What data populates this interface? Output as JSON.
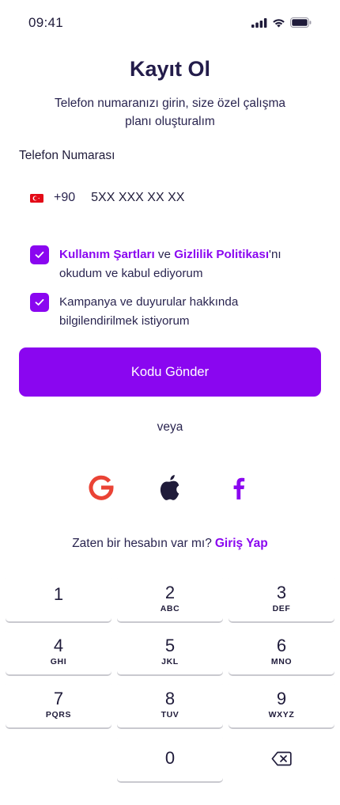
{
  "status_bar": {
    "time": "09:41",
    "icons": [
      "signal-icon",
      "wifi-icon",
      "battery-icon"
    ]
  },
  "header": {
    "title": "Kayıt Ol",
    "subtitle": "Telefon numaranızı girin, size özel çalışma planı oluşturalım"
  },
  "phone": {
    "label": "Telefon Numarası",
    "flag": "turkey-flag-icon",
    "country_code": "+90",
    "placeholder": "5XX XXX XX XX"
  },
  "consents": [
    {
      "checked": true,
      "terms_link": "Kullanım Şartları",
      "connector": " ve ",
      "privacy_link": "Gizlilik Politikası",
      "suffix": "'nı okudum ve kabul ediyorum"
    },
    {
      "checked": true,
      "text": "Kampanya ve duyurular hakkında bilgilendirilmek istiyorum"
    }
  ],
  "actions": {
    "send_code": "Kodu Gönder",
    "or": "veya"
  },
  "social": [
    "google-icon",
    "apple-icon",
    "facebook-icon"
  ],
  "login": {
    "prompt": "Zaten bir hesabın var mı?",
    "link": "Giriş Yap"
  },
  "keypad": [
    {
      "digit": "1",
      "letters": ""
    },
    {
      "digit": "2",
      "letters": "ABC"
    },
    {
      "digit": "3",
      "letters": "DEF"
    },
    {
      "digit": "4",
      "letters": "GHI"
    },
    {
      "digit": "5",
      "letters": "JKL"
    },
    {
      "digit": "6",
      "letters": "MNO"
    },
    {
      "digit": "7",
      "letters": "PQRS"
    },
    {
      "digit": "8",
      "letters": "TUV"
    },
    {
      "digit": "9",
      "letters": "WXYZ"
    },
    {
      "digit": "0",
      "letters": ""
    }
  ],
  "colors": {
    "accent": "#8a06f0",
    "text": "#1f1b3a",
    "google_red": "#ea4335"
  }
}
